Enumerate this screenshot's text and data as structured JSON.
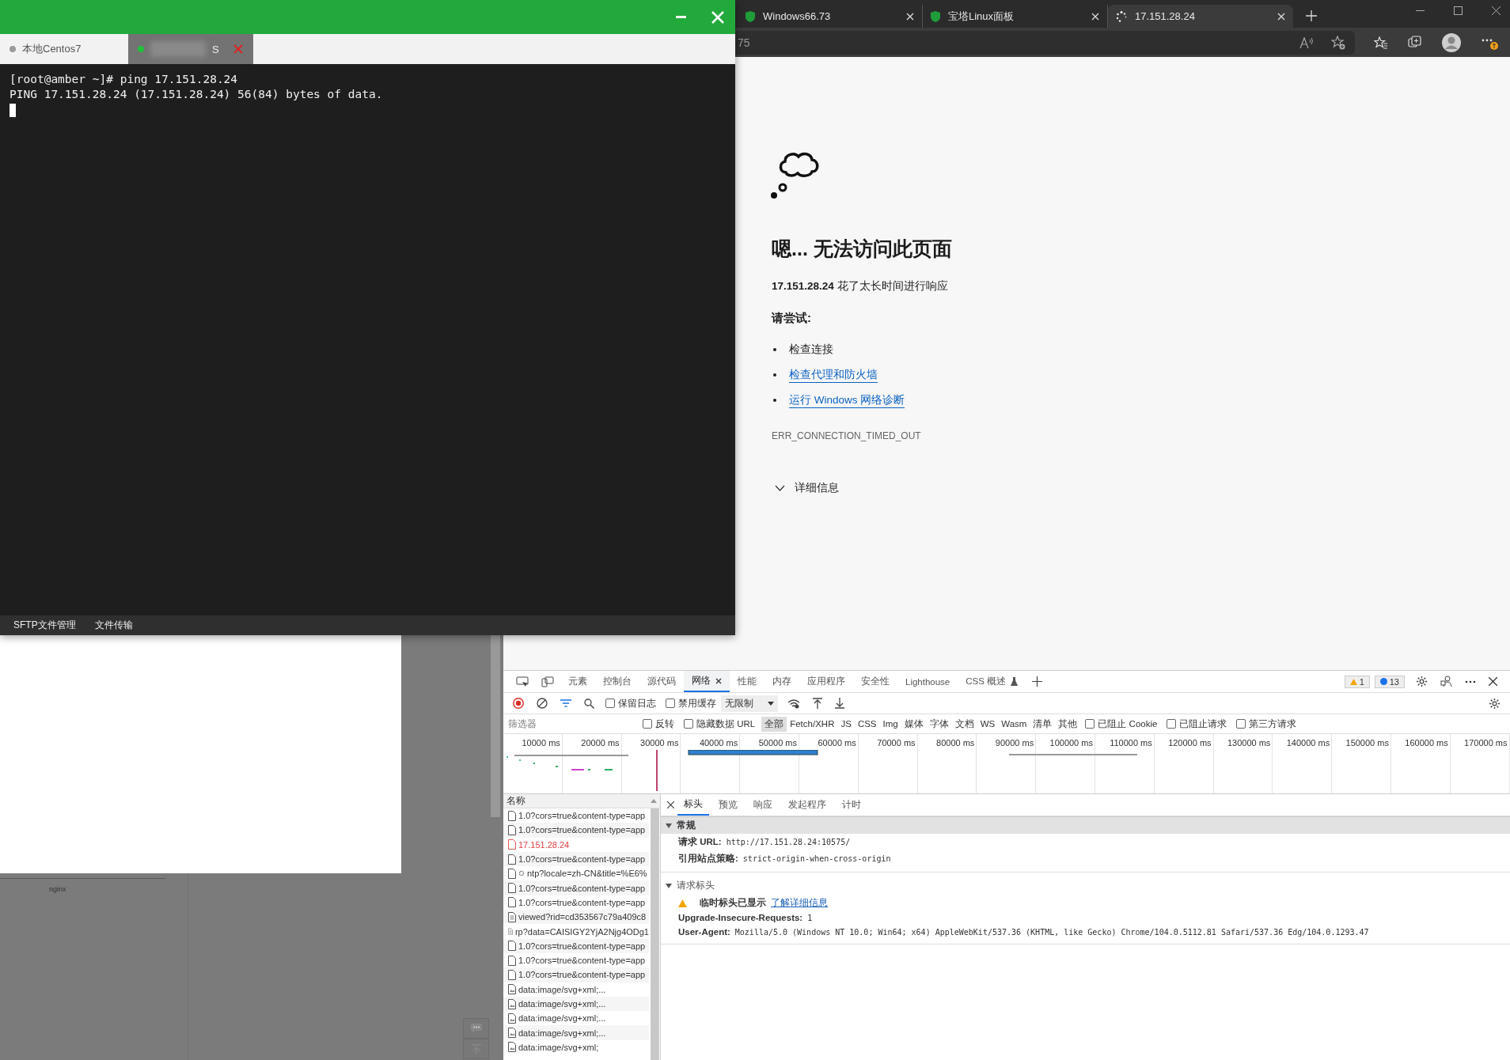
{
  "terminal_window": {
    "tabs": [
      {
        "label": "本地Centos7",
        "selected": false,
        "connected": false
      },
      {
        "label": "S",
        "selected": true,
        "connected": true
      }
    ],
    "lines": [
      "[root@amber ~]# ping 17.151.28.24",
      "PING 17.151.28.24 (17.151.28.24) 56(84) bytes of data."
    ],
    "bottom_tabs": [
      "SFTP文件管理",
      "文件传输"
    ]
  },
  "background_page": {
    "label": "nginx"
  },
  "browser": {
    "tabs": [
      {
        "title": "Windows66.73",
        "kind": "site",
        "selected": false
      },
      {
        "title": "宝塔Linux面板",
        "kind": "site",
        "selected": false
      },
      {
        "title": "17.151.28.24",
        "kind": "loading",
        "selected": true
      }
    ],
    "address": "75"
  },
  "error_page": {
    "heading": "嗯... 无法访问此页面",
    "message": "**17.151.28.24** 花了太长时间进行响应",
    "try_label": "请尝试:",
    "suggestions": [
      {
        "text": "检查连接",
        "kind": "text"
      },
      {
        "text": "检查代理和防火墙",
        "kind": "link"
      },
      {
        "text": "运行 Windows 网络诊断",
        "kind": "link"
      }
    ],
    "error_code": "ERR_CONNECTION_TIMED_OUT",
    "details": "详细信息"
  },
  "devtools": {
    "tabs": [
      {
        "label": "元素",
        "selected": false
      },
      {
        "label": "控制台",
        "selected": false
      },
      {
        "label": "源代码",
        "selected": false
      },
      {
        "label": "网络",
        "selected": true,
        "closable": true
      },
      {
        "label": "性能",
        "selected": false
      },
      {
        "label": "内存",
        "selected": false
      },
      {
        "label": "应用程序",
        "selected": false
      },
      {
        "label": "安全性",
        "selected": false
      },
      {
        "label": "Lighthouse",
        "selected": false
      },
      {
        "label": "CSS 概述",
        "selected": false,
        "kind": "experiment"
      }
    ],
    "warnings": "1",
    "messages": "13",
    "toolbar": {
      "recording": true,
      "checkboxes": [
        {
          "label": "保留日志",
          "checked": false
        },
        {
          "label": "禁用缓存",
          "checked": false
        }
      ],
      "throttling": "无限制"
    },
    "filter": {
      "placeholder": "筛选器",
      "options": [
        {
          "label": "反转",
          "checked": false
        },
        {
          "label": "隐藏数据 URL",
          "checked": false
        }
      ],
      "types": [
        {
          "label": "全部",
          "selected": true
        },
        {
          "label": "Fetch/XHR",
          "selected": false
        },
        {
          "label": "JS",
          "selected": false
        },
        {
          "label": "CSS",
          "selected": false
        },
        {
          "label": "Img",
          "selected": false
        },
        {
          "label": "媒体",
          "selected": false
        },
        {
          "label": "字体",
          "selected": false
        },
        {
          "label": "文档",
          "selected": false
        },
        {
          "label": "WS",
          "selected": false
        },
        {
          "label": "Wasm",
          "selected": false
        },
        {
          "label": "清单",
          "selected": false
        },
        {
          "label": "其他",
          "selected": false
        }
      ],
      "blocked": [
        {
          "label": "已阻止 Cookie",
          "checked": false
        },
        {
          "label": "已阻止请求",
          "checked": false
        },
        {
          "label": "第三方请求",
          "checked": false
        }
      ]
    },
    "overview": {
      "ticks": [
        "10000 ms",
        "20000 ms",
        "30000 ms",
        "40000 ms",
        "50000 ms",
        "60000 ms",
        "70000 ms",
        "80000 ms",
        "90000 ms",
        "100000 ms",
        "110000 ms",
        "120000 ms",
        "130000 ms",
        "140000 ms",
        "150000 ms",
        "160000 ms",
        "170000 ms"
      ]
    },
    "requests": {
      "header": "名称",
      "rows": [
        {
          "name": "1.0?cors=true&content-type=app",
          "kind": "document"
        },
        {
          "name": "1.0?cors=true&content-type=app",
          "kind": "document"
        },
        {
          "name": "17.151.28.24",
          "kind": "error"
        },
        {
          "name": "1.0?cors=true&content-type=app",
          "kind": "document"
        },
        {
          "name": "ntp?locale=zh-CN&title=%E6%",
          "kind": "settings"
        },
        {
          "name": "1.0?cors=true&content-type=app",
          "kind": "document"
        },
        {
          "name": "1.0?cors=true&content-type=app",
          "kind": "document"
        },
        {
          "name": "viewed?rid=cd353567c79a409c8",
          "kind": "script"
        },
        {
          "name": "rp?data=CAISIGY2YjA2Njg4ODg1",
          "kind": "script"
        },
        {
          "name": "1.0?cors=true&content-type=app",
          "kind": "document"
        },
        {
          "name": "1.0?cors=true&content-type=app",
          "kind": "document"
        },
        {
          "name": "1.0?cors=true&content-type=app",
          "kind": "document"
        },
        {
          "name": "data:image/svg+xml;...",
          "kind": "image"
        },
        {
          "name": "data:image/svg+xml;...",
          "kind": "image"
        },
        {
          "name": "data:image/svg+xml;...",
          "kind": "image"
        },
        {
          "name": "data:image/svg+xml;...",
          "kind": "image"
        },
        {
          "name": "data:image/svg+xml;",
          "kind": "image"
        }
      ]
    },
    "details": {
      "tabs": [
        {
          "label": "标头",
          "selected": true
        },
        {
          "label": "预览",
          "selected": false
        },
        {
          "label": "响应",
          "selected": false
        },
        {
          "label": "发起程序",
          "selected": false
        },
        {
          "label": "计时",
          "selected": false
        }
      ],
      "sections": [
        {
          "title": "常规",
          "expanded": true,
          "rows": [
            {
              "key": "请求 URL:",
              "value": "http://17.151.28.24:10575/"
            },
            {
              "key": "引用站点策略:",
              "value": "strict-origin-when-cross-origin"
            }
          ]
        },
        {
          "title": "请求标头",
          "expanded": true,
          "notice": {
            "text": "临时标头已显示",
            "link": "了解详细信息"
          },
          "rows": [
            {
              "key": "Upgrade-Insecure-Requests:",
              "value": "1"
            },
            {
              "key": "User-Agent:",
              "value": "Mozilla/5.0 (Windows NT 10.0; Win64; x64) AppleWebKit/537.36 (KHTML, like Gecko) Chrome/104.0.5112.81 Safari/537.36 Edg/104.0.1293.47"
            }
          ]
        }
      ]
    }
  }
}
